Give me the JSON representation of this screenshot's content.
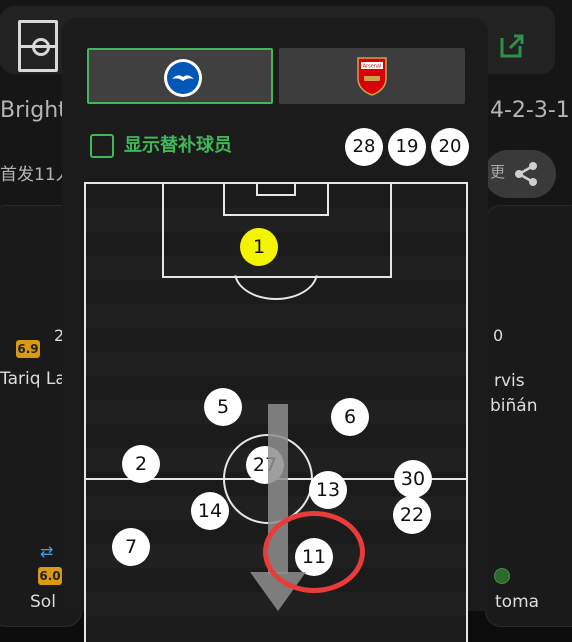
{
  "background": {
    "team_name": "Bright",
    "formation": "4-2-3-1",
    "starting_label": "首发11人",
    "sub_hint": "更",
    "left_player": {
      "rating": "6.9",
      "name": "Tariq La",
      "number": "2"
    },
    "right_player": {
      "name_line1": "rvis",
      "name_line2": "biñán",
      "number": "0"
    },
    "left_bottom": {
      "rating": "6.0",
      "name": "Sol"
    },
    "right_bottom": {
      "name": "toma"
    }
  },
  "modal": {
    "home_team": {
      "crest": "brighton-crest-icon",
      "selected": true
    },
    "away_team": {
      "crest": "arsenal-crest-icon",
      "crest_text": "Arsenal",
      "selected": false
    },
    "show_subs_label": "显示替补球员",
    "show_subs_checked": false,
    "bench_numbers": [
      "28",
      "19",
      "20"
    ],
    "players": [
      {
        "number": "1",
        "role": "goalkeeper"
      },
      {
        "number": "5"
      },
      {
        "number": "6"
      },
      {
        "number": "2"
      },
      {
        "number": "27"
      },
      {
        "number": "30"
      },
      {
        "number": "13"
      },
      {
        "number": "14"
      },
      {
        "number": "22"
      },
      {
        "number": "7"
      },
      {
        "number": "11"
      }
    ]
  },
  "colors": {
    "accent_green": "#3fb85a",
    "goalkeeper": "#f3f500",
    "annotation_red": "#ea3b3b",
    "rating_gold": "#d99a12"
  }
}
